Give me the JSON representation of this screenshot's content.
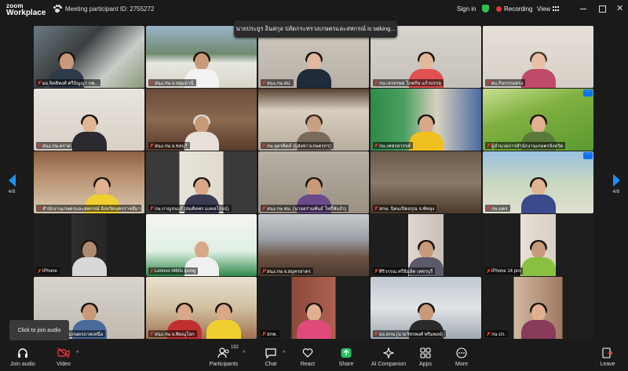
{
  "app": {
    "logo_line1": "zoom",
    "logo_line2": "Workplace",
    "meeting_id_text": "Meeting participant ID: 2755272",
    "sign_in": "Sign in",
    "recording": "Recording",
    "view": "View"
  },
  "talking_banner": "นายประยูร อินสกุล ปลัดกระทรวงเกษตรและสหกรณ์ is talking...",
  "pagination": {
    "left": "4/8",
    "right": "4/8"
  },
  "tooltip": "Click to join audio",
  "participants": [
    {
      "name": "ผอ.จิตติพงศ์ ศรีปัญญา กพ..."
    },
    {
      "name": "สนง.กษ.จ.ปทุมธานี"
    },
    {
      "name": "สนง.กษ.สป."
    },
    {
      "name": "กษ.เจรจรพล โภคกิจ แก้วบรรลุ"
    },
    {
      "name": "ผบ.กิจกรรมทรง"
    },
    {
      "name": "สนง.กษ.ตราด"
    },
    {
      "name": "สนง.กษ.จ.ชลบุรี"
    },
    {
      "name": "กษ.อุตรดิตถ์ (ผู้ส่งข่าวเกษตรกร)"
    },
    {
      "name": "กษ.เพชรสวรรค์"
    },
    {
      "name": "ผู้อำนวยการสำนักงานเกษตรจังหวัด"
    },
    {
      "name": "สำนักงานเกษตรและสหกรณ์ จังหวัดนครราชสีมา"
    },
    {
      "name": "กษ.กาญจนบุรี (สมคิดพร มงคลโรจน์)"
    },
    {
      "name": "สนง.กษ.ชม. (นายอร่ามพันธ์ โพธิ์พันธ์ร)"
    },
    {
      "name": "สกษ. นิคมเปิดอรุณ จ.พัทลุง"
    },
    {
      "name": "กษ.นคร"
    },
    {
      "name": "iPhone"
    },
    {
      "name": "Lenovo t460s ipong"
    },
    {
      "name": "สนง.กษ.จ.สมุทรสาคร"
    },
    {
      "name": "ศิริวรรณ ศรีอิมส์ค เพชรบุรี"
    },
    {
      "name": "iPhone 14 pro"
    },
    {
      "name": "บร. สำนักงานเกษตรภาคเหนือ"
    },
    {
      "name": "สนง.กษ.จ.พิษณุโลก"
    },
    {
      "name": "สกพ."
    },
    {
      "name": "ผอ.สกษ.(นายวัชรพงศ์ พริมพงษ์)"
    },
    {
      "name": "กษ.ปร."
    }
  ],
  "toolbar": {
    "join_audio": "Join audio",
    "video": "Video",
    "participants": "Participants",
    "participant_count": "192",
    "chat": "Chat",
    "react": "React",
    "share": "Share",
    "ai_companion": "AI Companion",
    "apps": "Apps",
    "more": "More",
    "leave": "Leave"
  },
  "colors": {
    "accent_blue": "#0e72ed",
    "nav_blue": "#1e8ff5",
    "share_green": "#22c55e",
    "recording_red": "#e5323f",
    "security_green": "#2fbf4a",
    "leave_red": "#e5323f"
  }
}
